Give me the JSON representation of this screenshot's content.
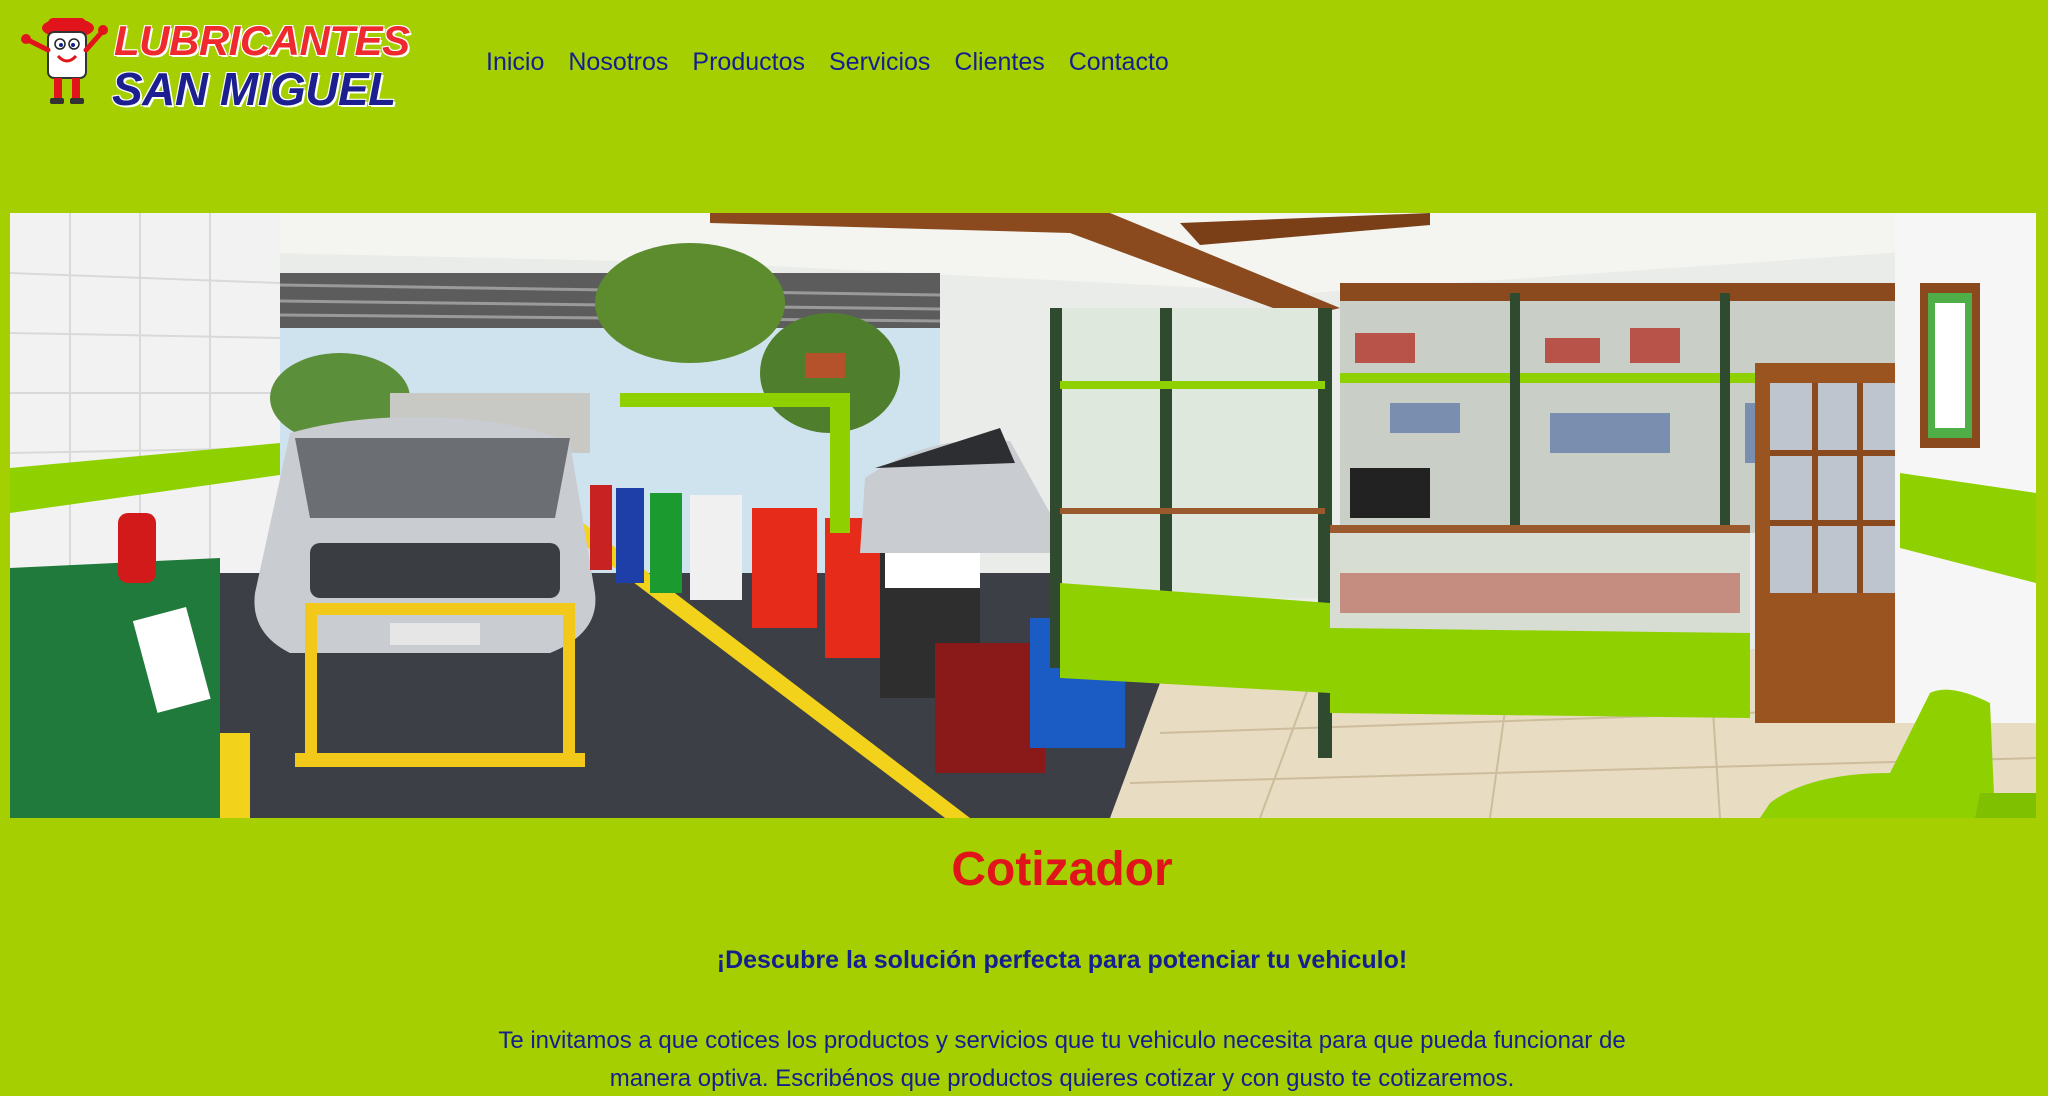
{
  "brand": {
    "line1": "LUBRICANTES",
    "line2": "SAN MIGUEL",
    "mascot_icon": "oil-can-mascot-icon"
  },
  "nav": {
    "items": [
      {
        "label": "Inicio"
      },
      {
        "label": "Nosotros"
      },
      {
        "label": "Productos"
      },
      {
        "label": "Servicios"
      },
      {
        "label": "Clientes"
      },
      {
        "label": "Contacto"
      }
    ]
  },
  "colors": {
    "background": "#a6cf02",
    "title": "#e1141b",
    "text": "#15208f",
    "brand_red": "#ee2a2f",
    "brand_blue": "#1c1f8f"
  },
  "main": {
    "title": "Cotizador",
    "subtitle": "¡Descubre la solución perfecta para potenciar tu vehiculo!",
    "paragraph": "Te invitamos a que cotices los productos y servicios que tu vehiculo necesita para que pueda funcionar de manera optiva. Escribénos que productos quieres cotizar y con gusto te cotizaremos."
  }
}
